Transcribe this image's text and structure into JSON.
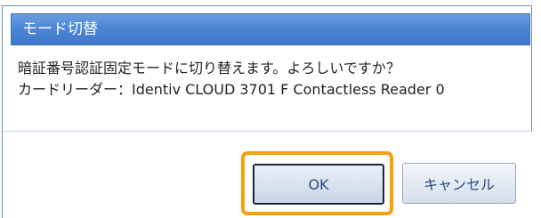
{
  "dialog": {
    "title": "モード切替",
    "message_line1": "暗証番号認証固定モードに切り替えます。よろしいですか？",
    "message_line2": "カードリーダー：Identiv CLOUD 3701 F Contactless Reader 0",
    "ok_label": "OK",
    "cancel_label": "キャンセル"
  },
  "colors": {
    "titlebar": "#4c86d4",
    "highlight": "#f4a10c"
  }
}
